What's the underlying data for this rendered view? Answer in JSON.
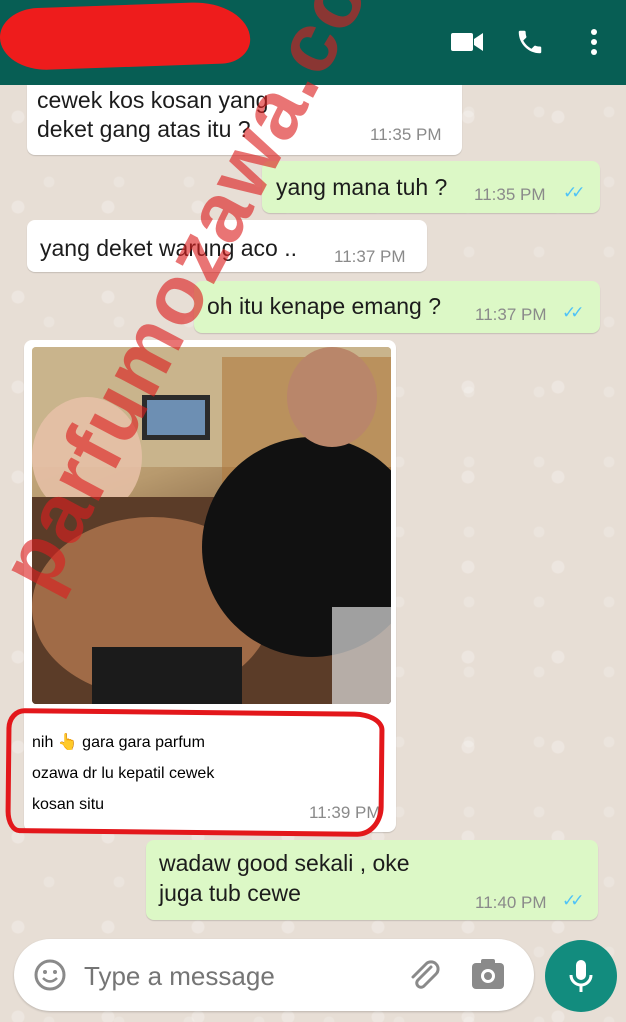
{
  "header": {
    "video_icon": "video-call-icon",
    "call_icon": "phone-icon",
    "menu_icon": "more-vert-icon"
  },
  "messages": [
    {
      "type": "in",
      "lines": [
        "cewek kos kosan yang",
        "deket gang atas itu ?"
      ],
      "time": "11:35 PM"
    },
    {
      "type": "out",
      "text": "yang mana tuh ?",
      "time": "11:35 PM"
    },
    {
      "type": "in",
      "text": "yang deket warung aco ..",
      "time": "11:37 PM"
    },
    {
      "type": "out",
      "text": "oh itu kenape emang ?",
      "time": "11:37 PM"
    },
    {
      "type": "in-photo",
      "lines": [
        "nih 👆 gara gara parfum",
        "ozawa dr lu  kepatil cewek",
        "kosan situ"
      ],
      "time": "11:39 PM"
    },
    {
      "type": "out",
      "lines": [
        "wadaw good sekali , oke",
        "juga tub cewe"
      ],
      "time": "11:40 PM"
    }
  ],
  "watermark": "parfumozawa.com",
  "composer": {
    "placeholder": "Type a message",
    "emoji_icon": "emoji-icon",
    "attach_icon": "paperclip-icon",
    "camera_icon": "camera-icon",
    "mic_icon": "mic-icon"
  },
  "colors": {
    "header": "#075e54",
    "outgoing": "#dcf8c6",
    "read_ticks": "#4fc3f7",
    "mic": "#128c7e"
  }
}
